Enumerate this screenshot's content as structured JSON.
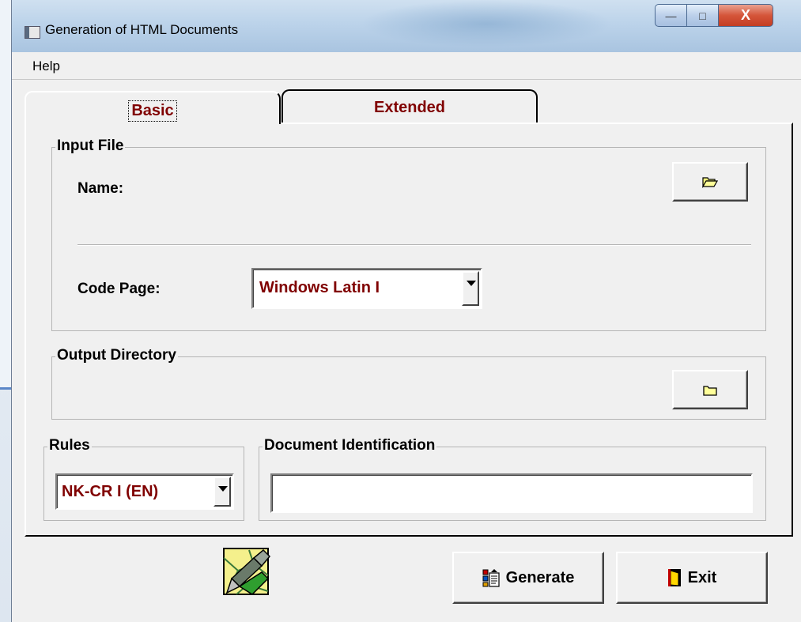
{
  "window": {
    "title": "Generation of HTML Documents",
    "controls": {
      "minimize": "—",
      "maximize": "□",
      "close": "X"
    }
  },
  "menu": {
    "items": [
      {
        "label": "Help"
      }
    ]
  },
  "tabs": [
    {
      "label": "Basic",
      "selected": true
    },
    {
      "label": "Extended",
      "selected": false
    }
  ],
  "basic": {
    "input_file": {
      "group_label": "Input File",
      "name_label": "Name:",
      "browse_icon": "open-folder-icon"
    },
    "code_page": {
      "label": "Code Page:",
      "selected": "Windows Latin I"
    },
    "output_directory": {
      "group_label": "Output Directory",
      "browse_icon": "folder-icon"
    },
    "rules": {
      "group_label": "Rules",
      "selected": "NK-CR I (EN)"
    },
    "document_identification": {
      "group_label": "Document Identification",
      "value": ""
    }
  },
  "footer": {
    "generate_label": "Generate",
    "exit_label": "Exit",
    "logo_icon": "html-document-pen-icon"
  },
  "colors": {
    "accent_text": "#800000",
    "dialog_bg": "#f0f0f0",
    "close_button": "#c33d22"
  }
}
